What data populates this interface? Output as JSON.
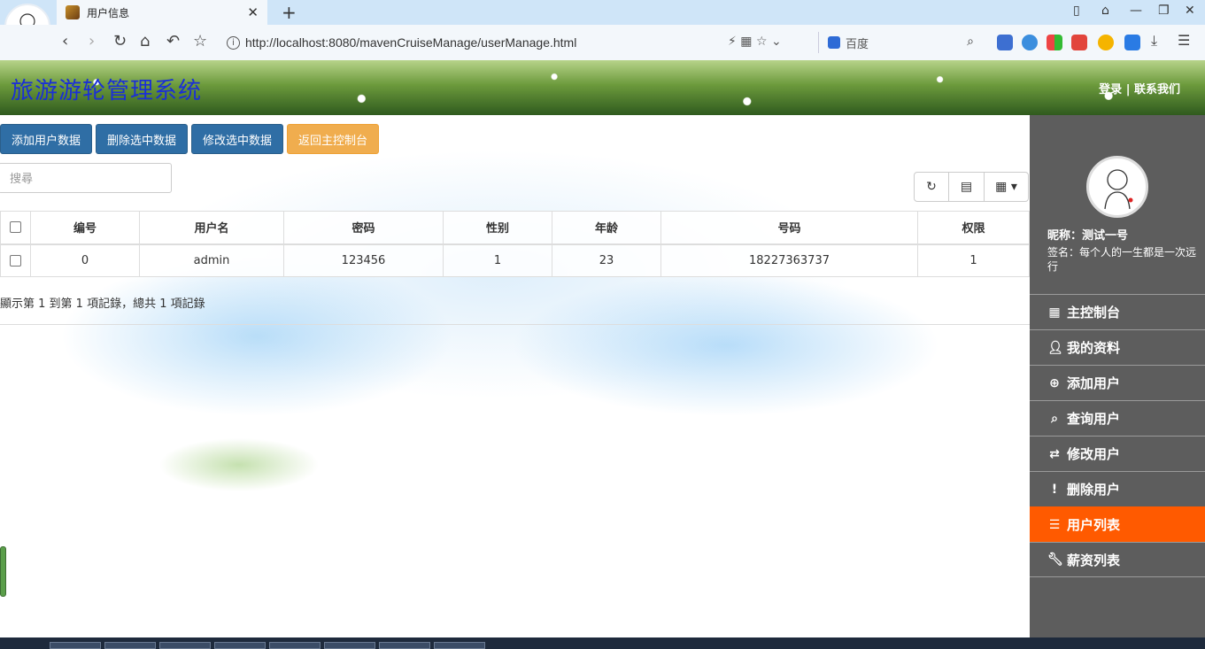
{
  "browser": {
    "tab_title": "用户信息",
    "url": "http://localhost:8080/mavenCruiseManage/userManage.html",
    "search_engine": "百度"
  },
  "banner": {
    "title": "旅游游轮管理系统",
    "login": "登录",
    "separator": "|",
    "contact": "联系我们"
  },
  "toolbar": {
    "add": "添加用户数据",
    "delete": "删除选中数据",
    "edit": "修改选中数据",
    "back": "返回主控制台"
  },
  "search": {
    "placeholder": "搜尋"
  },
  "table": {
    "headers": [
      "编号",
      "用户名",
      "密码",
      "性别",
      "年龄",
      "号码",
      "权限"
    ],
    "rows": [
      [
        "0",
        "admin",
        "123456",
        "1",
        "23",
        "18227363737",
        "1"
      ]
    ]
  },
  "pager": {
    "text": "顯示第 1 到第 1 項記錄，總共 1 項記錄"
  },
  "sidebar": {
    "nickname": "昵称：测试一号",
    "signature": "签名：每个人的一生都是一次远行",
    "menu": [
      {
        "label": "主控制台",
        "icon": "dashboard-icon"
      },
      {
        "label": "我的资料",
        "icon": "user-icon"
      },
      {
        "label": "添加用户",
        "icon": "plus-circle-icon"
      },
      {
        "label": "查询用户",
        "icon": "search-icon"
      },
      {
        "label": "修改用户",
        "icon": "retweet-icon"
      },
      {
        "label": "删除用户",
        "icon": "exclamation-icon"
      },
      {
        "label": "用户列表",
        "icon": "list-icon"
      },
      {
        "label": "薪资列表",
        "icon": "wrench-icon"
      }
    ],
    "active_index": 6
  },
  "colors": {
    "accent_active": "#ff5a00",
    "sidebar_bg": "#5d5d5d",
    "primary_button": "#337ab7",
    "warning_button": "#f0ad4e",
    "banner_title": "#1a2fd6"
  }
}
